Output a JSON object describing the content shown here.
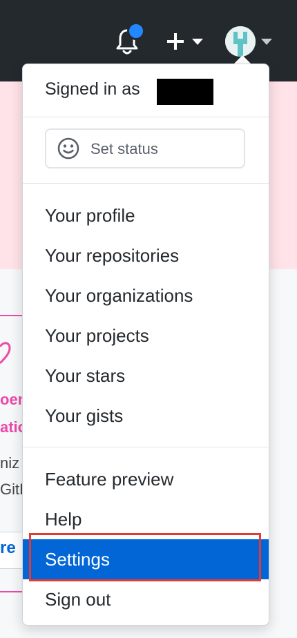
{
  "header": {
    "notifications_icon": "bell-icon",
    "new_icon": "plus-icon",
    "profile_icon": "avatar-icon"
  },
  "background": {
    "fragment_pink_1": "oen",
    "fragment_pink_2": "atio",
    "fragment_gray_1": "niz",
    "fragment_gray_2": "GitH",
    "fragment_blue": "re"
  },
  "menu": {
    "signed_in_label": "Signed in as",
    "set_status_label": "Set status",
    "items": [
      {
        "label": "Your profile"
      },
      {
        "label": "Your repositories"
      },
      {
        "label": "Your organizations"
      },
      {
        "label": "Your projects"
      },
      {
        "label": "Your stars"
      },
      {
        "label": "Your gists"
      },
      {
        "label": "Feature preview"
      },
      {
        "label": "Help"
      },
      {
        "label": "Settings"
      },
      {
        "label": "Sign out"
      }
    ],
    "active_item": "Settings"
  },
  "colors": {
    "topbar": "#24292e",
    "accent": "#0366d6",
    "badge": "#2188ff",
    "highlight_border": "#e53935",
    "banner": "#ffe3e8",
    "pink_text": "#ea4aaa"
  }
}
